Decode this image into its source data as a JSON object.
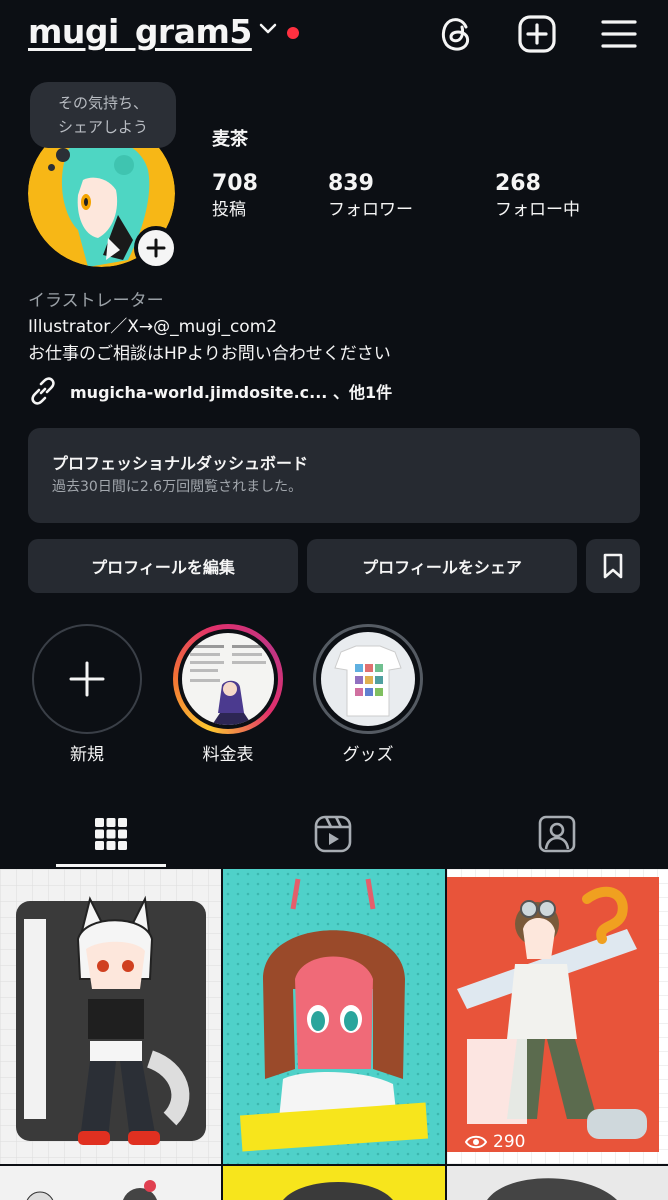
{
  "header": {
    "username": "mugi_gram5",
    "icons": [
      "chevron-down-icon",
      "threads-icon",
      "plus-square-icon",
      "menu-icon"
    ],
    "notification_color": "#ff3040"
  },
  "note_bubble": {
    "line1": "その気持ち、",
    "line2": "シェアしよう"
  },
  "profile": {
    "display_name": "麦茶",
    "stats": [
      {
        "value": "708",
        "label": "投稿"
      },
      {
        "value": "839",
        "label": "フォロワー"
      },
      {
        "value": "268",
        "label": "フォロー中"
      }
    ],
    "category": "イラストレーター",
    "bio_line1": "Illustrator／X→@_mugi_com2",
    "bio_line2": "お仕事のご相談はHPよりお問い合わせください",
    "link_text": "mugicha-world.jimdosite.c... 、他1件"
  },
  "dashboard": {
    "title": "プロフェッショナルダッシュボード",
    "subtitle": "過去30日間に2.6万回閲覧されました。"
  },
  "buttons": {
    "edit_profile": "プロフィールを編集",
    "share_profile": "プロフィールをシェア"
  },
  "highlights": [
    {
      "label": "新規"
    },
    {
      "label": "料金表"
    },
    {
      "label": "グッズ"
    }
  ],
  "tabs": [
    "grid-icon",
    "reels-icon",
    "tagged-icon"
  ],
  "posts": [
    {
      "alt_theme": "wolf-girl",
      "bg": "#f2f2f2"
    },
    {
      "alt_theme": "pink-girl",
      "bg": "#4fd1c9"
    },
    {
      "alt_theme": "leo",
      "bg": "#ffffff",
      "views": "290"
    }
  ],
  "colors": {
    "background": "#0c0f14",
    "card": "#262a31",
    "accent_red": "#ff3040"
  }
}
